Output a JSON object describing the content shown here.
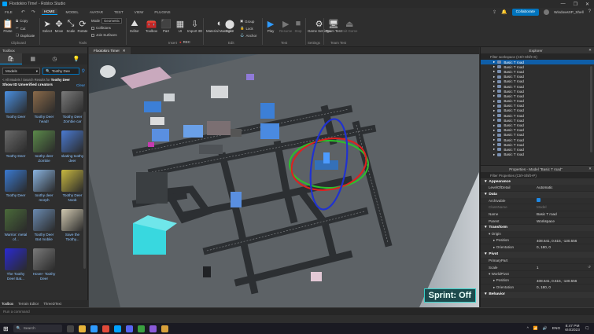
{
  "window": {
    "title": "Flootokiro Time! - Roblox Studio",
    "controls": [
      "—",
      "❐",
      "✕"
    ]
  },
  "menubar": {
    "file": "FILE",
    "tabs": [
      "HOME",
      "MODEL",
      "AVATAR",
      "TEST",
      "VIEW",
      "PLUGINS"
    ],
    "active": "HOME",
    "collaborate": "Collaborate",
    "user": "WindowsXP_Shell",
    "accent": "#00a2ff"
  },
  "ribbon": {
    "clipboard": {
      "paste": "Paste",
      "copy": "Copy",
      "cut": "Cut",
      "duplicate": "Duplicate",
      "group": "Clipboard"
    },
    "tools": {
      "select": "Select",
      "move": "Move",
      "scale": "Scale",
      "rotate": "Rotate",
      "group": "Tools"
    },
    "mode": {
      "label": "Mode",
      "value": "Geometric",
      "collisions": "Collisions",
      "join": "Join Surfaces"
    },
    "terrain": {
      "editor": "Editor"
    },
    "insert": {
      "toolbox": "Toolbox",
      "part": "Part",
      "ui": "UI",
      "import3d": "Import 3D",
      "group": "Insert"
    },
    "file_group": "File",
    "edit": {
      "material": "Material Manager",
      "color": "Color",
      "group": "Edit",
      "rec": "REC"
    },
    "arrange": {
      "group_btn": "Group",
      "lock": "Lock",
      "anchor": "Anchor"
    },
    "test": {
      "play": "Play",
      "resume": "Resume",
      "stop": "Stop",
      "group": "Test"
    },
    "settings": {
      "game": "Game Settings",
      "group": "Settings"
    },
    "teamtest": {
      "team": "Team Test",
      "exit": "Exit Game",
      "group": "Team Test"
    }
  },
  "toolbox": {
    "title": "Toolbox",
    "dropdown": "Models",
    "search_value": "Toothy Dee",
    "crumb_prefix": "< All Models / Search Results for ",
    "crumb_query": "Toothy Deer",
    "unverified": "Show ID Unverified creators",
    "clear": "Clear",
    "items": [
      {
        "name": "Toothy Deer",
        "color": "#4a90e2"
      },
      {
        "name": "Toothy Deer head!",
        "color": "#8a6a4a"
      },
      {
        "name": "Toothy Deer Zombie car",
        "color": "#7a7a7a"
      },
      {
        "name": "Toothy Deer",
        "color": "#6a6a6a"
      },
      {
        "name": "toothy deer Zombie",
        "color": "#5b8a4a"
      },
      {
        "name": "skating toothy deer",
        "color": "#4a7ad2"
      },
      {
        "name": "Toothy Deer",
        "color": "#3a7ad2"
      },
      {
        "name": "toothy deer morph",
        "color": "#8ab4e0"
      },
      {
        "name": "Toothy Deer Noob",
        "color": "#c8b840"
      },
      {
        "name": "Warrior: metal of...",
        "color": "#4a6a3a"
      },
      {
        "name": "Toothy Deer Bat mobile",
        "color": "#6a8ab0"
      },
      {
        "name": "Save the Toothy...",
        "color": "#d0c8b0"
      },
      {
        "name": "The Toothy Deer Bat...",
        "color": "#2a2ad2"
      },
      {
        "name": "Hover- Toothy Deer",
        "color": "#7a7a7a"
      }
    ]
  },
  "bottom_tabs": [
    "Toolbox",
    "Terrain Editor",
    "ThreeDText"
  ],
  "command_bar": {
    "placeholder": "Run a command"
  },
  "viewport": {
    "tab": "Flootokiro Time!",
    "sprint": "Sprint: Off"
  },
  "explorer": {
    "title": "Explorer",
    "filter": "Filter workspace (Ctrl+Shift+X)",
    "rows": [
      "Basic T road",
      "Basic T road",
      "Basic T road",
      "Basic T road",
      "Basic T road",
      "Basic T road",
      "Basic T road",
      "Basic T road",
      "Basic T road",
      "Basic T road",
      "Basic T road",
      "Basic T road",
      "Basic T road",
      "Basic T road",
      "Basic T road",
      "Basic T road",
      "Basic T road",
      "Basic T road",
      "Basic T road",
      "Basic T road"
    ],
    "selected_index": 0
  },
  "properties": {
    "title": "Properties - Model \"Basic T road\"",
    "filter": "Filter Properties (Ctrl+Shift+P)",
    "sections": {
      "appearance": "Appearance",
      "data": "Data",
      "transform": "Transform",
      "pivot": "Pivot",
      "behavior": "Behavior"
    },
    "level_of_detail": {
      "k": "LevelOfDetail",
      "v": "Automatic"
    },
    "archivable": {
      "k": "Archivable"
    },
    "classname": {
      "k": "ClassName",
      "v": "Model"
    },
    "name": {
      "k": "Name",
      "v": "Basic T road"
    },
    "parent": {
      "k": "Parent",
      "v": "Workspace"
    },
    "origin": {
      "k": "Origin"
    },
    "origin_pos": {
      "k": "Position",
      "v": "408.641, 0.615, -130.556"
    },
    "origin_ori": {
      "k": "Orientation",
      "v": "0, 180, 0"
    },
    "primary": {
      "k": "PrimaryPart"
    },
    "scale": {
      "k": "Scale",
      "v": "1"
    },
    "world_pivot": {
      "k": "WorldPivot"
    },
    "wp_pos": {
      "k": "Position",
      "v": "408.641, 0.615, -130.556"
    },
    "wp_ori": {
      "k": "Orientation",
      "v": "0, 180, 0"
    }
  },
  "taskbar": {
    "search": "Search",
    "lang": "ENG",
    "time": "8:47 PM",
    "date": "6/4/2023"
  }
}
